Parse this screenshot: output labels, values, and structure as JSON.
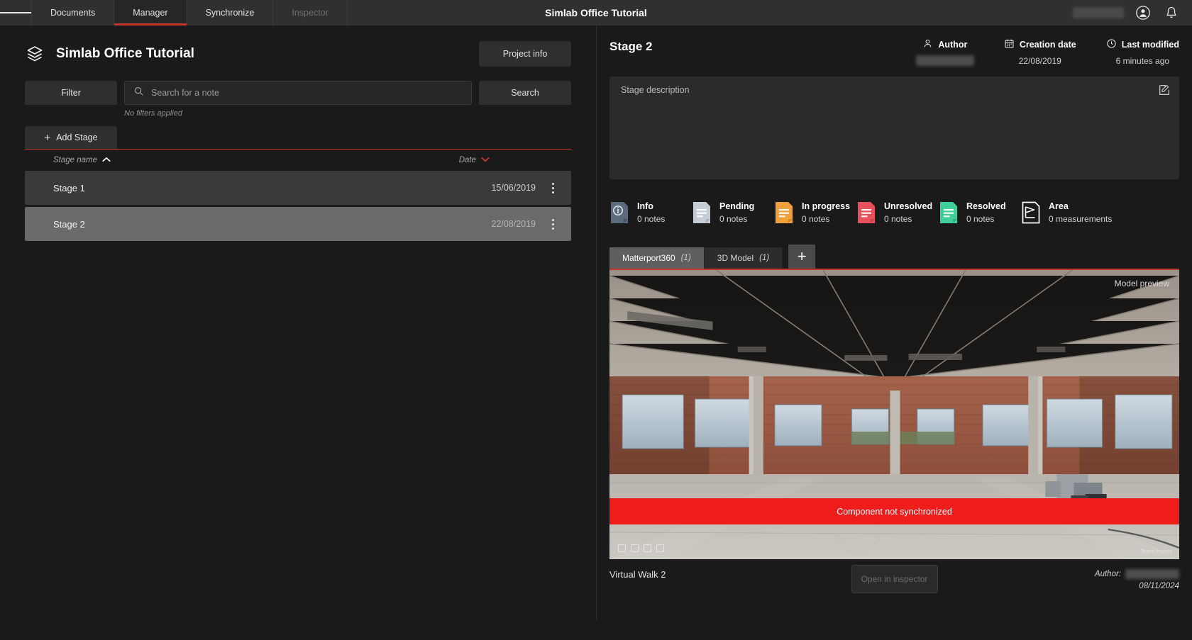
{
  "topbar": {
    "menu_icon": "hamburger-icon",
    "tabs": [
      {
        "label": "Documents",
        "state": "normal"
      },
      {
        "label": "Manager",
        "state": "active"
      },
      {
        "label": "Synchronize",
        "state": "normal"
      },
      {
        "label": "Inspector",
        "state": "disabled"
      }
    ],
    "app_title": "Simlab Office Tutorial",
    "user_name_redacted": "",
    "account_icon": "user-circle-icon",
    "notifications_icon": "bell-icon"
  },
  "left": {
    "project_icon": "layers-stack-icon",
    "project_title": "Simlab Office Tutorial",
    "project_info_label": "Project info",
    "filter_label": "Filter",
    "search_placeholder": "Search for a note",
    "search_value": "",
    "search_button_label": "Search",
    "no_filters_text": "No filters applied",
    "add_stage_label": "Add Stage",
    "columns": {
      "name": "Stage name",
      "date": "Date"
    },
    "sort": {
      "name_dir": "asc",
      "date_dir": "desc"
    },
    "stages": [
      {
        "name": "Stage 1",
        "date": "15/06/2019",
        "selected": false
      },
      {
        "name": "Stage 2",
        "date": "22/08/2019",
        "selected": true
      }
    ]
  },
  "right": {
    "stage_name": "Stage 2",
    "meta": [
      {
        "icon": "person-icon",
        "label": "Author",
        "value": "",
        "redacted": true
      },
      {
        "icon": "calendar-icon",
        "label": "Creation date",
        "value": "22/08/2019",
        "redacted": false
      },
      {
        "icon": "clock-icon",
        "label": "Last modified",
        "value": "6 minutes ago",
        "redacted": false
      }
    ],
    "description_placeholder": "Stage description",
    "description_edit_icon": "edit-square-icon",
    "statuses": [
      {
        "label": "Info",
        "count": "0 notes",
        "color": "#5b6a7d",
        "icon": "info-note-icon"
      },
      {
        "label": "Pending",
        "count": "0 notes",
        "color": "#c6ccd4",
        "icon": "pending-note-icon"
      },
      {
        "label": "In progress",
        "count": "0 notes",
        "color": "#f0a13c",
        "icon": "in-progress-note-icon"
      },
      {
        "label": "Unresolved",
        "count": "0 notes",
        "color": "#e8505b",
        "icon": "unresolved-note-icon"
      },
      {
        "label": "Resolved",
        "count": "0 notes",
        "color": "#3fcf9a",
        "icon": "resolved-note-icon"
      },
      {
        "label": "Area",
        "count": "0 measurements",
        "color": "#ffffff",
        "icon": "area-measure-icon"
      }
    ],
    "view_tabs": [
      {
        "label": "Matterport360",
        "count": "(1)",
        "active": true
      },
      {
        "label": "3D Model",
        "count": "(1)",
        "active": false
      }
    ],
    "add_tab_icon": "plus-icon",
    "preview_label": "Model preview",
    "sync_warning": "Component not synchronized",
    "matterport_brand": "Terms  Privacy",
    "walk_name": "Virtual Walk 2",
    "open_inspector_label": "Open in inspector",
    "footer_author_label": "Author:",
    "footer_author_value": "",
    "footer_date": "08/11/2024"
  },
  "colors": {
    "accent_red": "#c0392b",
    "warning_red": "#ef1c1c",
    "bg": "#1a1a1a",
    "panel": "#2b2b2b"
  }
}
